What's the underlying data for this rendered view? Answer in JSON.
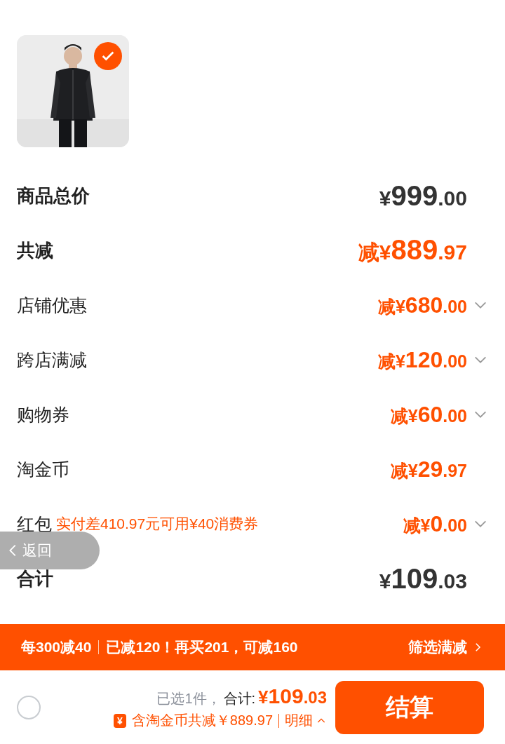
{
  "product": {
    "kind": "picture",
    "checked": true
  },
  "rows": [
    {
      "kind": "summary",
      "label": "商品总价",
      "currency": "¥",
      "whole": "999",
      "cents": ".00",
      "expandable": false
    },
    {
      "kind": "saving",
      "label": "共减",
      "currency": "减¥",
      "whole": "889",
      "cents": ".97",
      "expandable": false
    },
    {
      "kind": "item",
      "label": "店铺优惠",
      "currency": "减¥",
      "whole": "680",
      "cents": ".00",
      "expandable": true
    },
    {
      "kind": "item",
      "label": "跨店满减",
      "currency": "减¥",
      "whole": "120",
      "cents": ".00",
      "expandable": true
    },
    {
      "kind": "item",
      "label": "购物券",
      "currency": "减¥",
      "whole": "60",
      "cents": ".00",
      "expandable": true
    },
    {
      "kind": "item",
      "label": "淘金币",
      "currency": "减¥",
      "whole": "29",
      "cents": ".97",
      "expandable": false
    },
    {
      "kind": "item",
      "label": "红包",
      "note": "实付差410.97元可用¥40消费券",
      "currency": "减¥",
      "whole": "0",
      "cents": ".00",
      "expandable": true
    },
    {
      "kind": "summary",
      "label": "合计",
      "currency": "¥",
      "whole": "109",
      "cents": ".03",
      "expandable": false
    }
  ],
  "back_button": {
    "label": "返回"
  },
  "promo_bar": {
    "rule": "每300减40",
    "status": "已减120！再买201，可减160",
    "action": "筛选满减"
  },
  "checkout": {
    "select_all": {
      "selected": false
    },
    "count": "已选1件，",
    "total_label": "合计:",
    "currency": "¥",
    "whole": "109",
    "cents": ".03",
    "coin_badge": "¥",
    "saving": "含淘金币共减￥889.97",
    "details": "明细",
    "button": "结算"
  }
}
